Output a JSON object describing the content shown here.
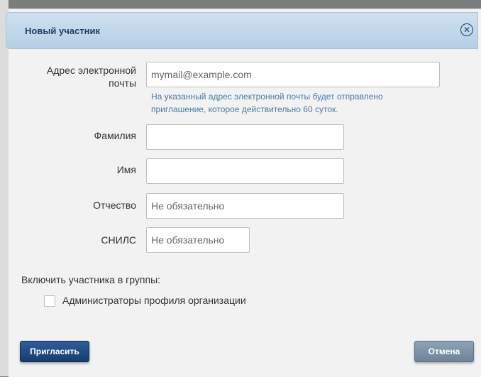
{
  "dialog": {
    "title": "Новый участник",
    "close_icon": "close-icon"
  },
  "form": {
    "email": {
      "label": "Адрес электронной почты",
      "value": "",
      "placeholder": "mymail@example.com",
      "hint": "На указанный адрес электронной почты будет отправлено приглашение, которое действительно 60 суток."
    },
    "last_name": {
      "label": "Фамилия",
      "value": "",
      "placeholder": ""
    },
    "first_name": {
      "label": "Имя",
      "value": "",
      "placeholder": ""
    },
    "middle_name": {
      "label": "Отчество",
      "value": "",
      "placeholder": "Не обязательно"
    },
    "snils": {
      "label": "СНИЛС",
      "value": "",
      "placeholder": "Не обязательно"
    }
  },
  "groups": {
    "label": "Включить участника в группы:",
    "items": [
      {
        "label": "Администраторы профиля организации",
        "checked": false
      }
    ]
  },
  "actions": {
    "invite_label": "Пригласить",
    "cancel_label": "Отмена"
  },
  "colors": {
    "header": "#b6cfe6",
    "title": "#1e3f66",
    "hint": "#4b7aa8",
    "primary_button": "#173d6e",
    "secondary_button": "#6f8398"
  }
}
